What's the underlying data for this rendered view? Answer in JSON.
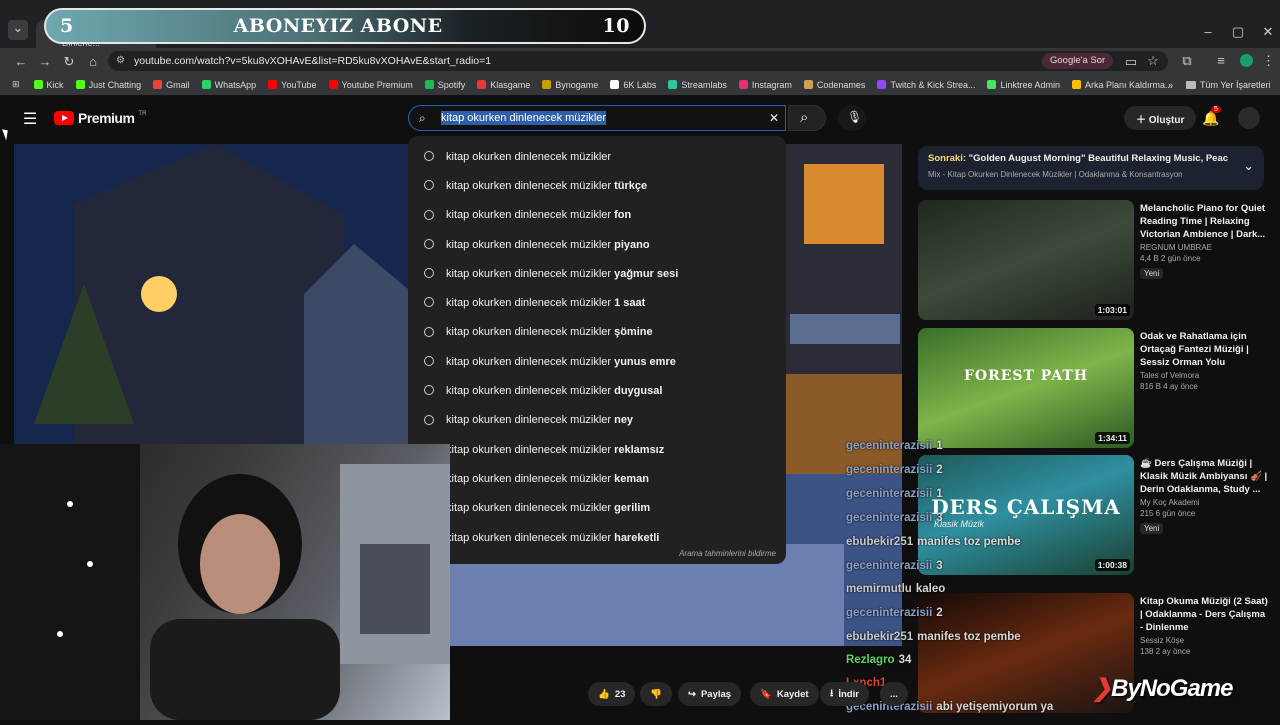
{
  "overlay": {
    "left_number": "5",
    "title": "ABONEYIZ ABONE",
    "right_number": "10"
  },
  "browser": {
    "tab_title": "Kitap Okurken Dinlene...",
    "url": "youtube.com/watch?v=5ku8vXOHAvE&list=RD5ku8vXOHAvE&start_radio=1",
    "google_button": "Google'a Sor",
    "bookmarks": [
      {
        "label": "Kick",
        "color": "#53fc18"
      },
      {
        "label": "Just Chatting",
        "color": "#53fc18"
      },
      {
        "label": "Gmail",
        "color": "#ea4335"
      },
      {
        "label": "WhatsApp",
        "color": "#25d366"
      },
      {
        "label": "YouTube",
        "color": "#ff0000"
      },
      {
        "label": "Youtube Premium",
        "color": "#ff0000"
      },
      {
        "label": "Spotify",
        "color": "#1db954"
      },
      {
        "label": "Klasgame",
        "color": "#e53935"
      },
      {
        "label": "Bynogame",
        "color": "#c8a000"
      },
      {
        "label": "6K Labs",
        "color": "#ffffff"
      },
      {
        "label": "Streamlabs",
        "color": "#31c3a2"
      },
      {
        "label": "Instagram",
        "color": "#e1306c"
      },
      {
        "label": "Codenames",
        "color": "#d0a050"
      },
      {
        "label": "Twitch & Kick Strea...",
        "color": "#9146ff"
      },
      {
        "label": "Linktree Admin",
        "color": "#43e660"
      },
      {
        "label": "Arka Planı Kaldırma...",
        "color": "#f6c000"
      }
    ],
    "bookmarks_more": "»",
    "all_bookmarks": "Tüm Yer İşaretleri"
  },
  "youtube": {
    "logo_text": "Premium",
    "logo_sup": "TR",
    "search_value": "kitap okurken dinlenecek müzikler",
    "create_label": "Oluştur",
    "notif_count": "5",
    "suggestion_base": "kitap okurken dinlenecek müzikler",
    "suggestions": [
      "",
      "türkçe",
      "fon",
      "piyano",
      "yağmur sesi",
      "1 saat",
      "şömine",
      "yunus emre",
      "duygusal",
      "ney",
      "reklamsız",
      "keman",
      "gerilim",
      "hareketli"
    ],
    "suggestion_footer": "Arama tahminlerini bildirme",
    "next": {
      "prefix": "Sonraki:",
      "title": "\"Golden August Morning\" Beautiful Relaxing Music, Peaceful ...",
      "sub": "Mix - Kitap Okurken Dinlenecek Müzikler | Odaklanma & Konsantrasyon"
    },
    "recommendations": [
      {
        "title": "Melancholic Piano for Quiet Reading Time | Relaxing Victorian Ambience | Dark...",
        "channel": "REGNUM UMBRAE",
        "views": "4,4 B",
        "age": "2 gün önce",
        "badge": "Yeni",
        "duration": "1:03:01"
      },
      {
        "title": "Odak ve Rahatlama için Ortaçağ Fantezi Müziği | Sessiz Orman Yolu",
        "channel": "Tales of Velmora",
        "views": "816 B",
        "age": "4 ay önce",
        "badge": "",
        "duration": "1:34:11",
        "thumb_text": "FOREST PATH"
      },
      {
        "title": "☕ Ders Çalışma Müziği | Klasik Müzik Ambiyansı 🎻 | Derin Odaklanma, Study ...",
        "channel": "My Koç Akademi",
        "views": "215",
        "age": "6 gün önce",
        "badge": "Yeni",
        "duration": "1:00:38",
        "thumb_text": "DERS ÇALIŞMA",
        "thumb_sub": "Klasik Müzik"
      },
      {
        "title": "Kitap Okuma Müziği (2 Saat) | Odaklanma - Ders Çalışma - Dinlenme",
        "channel": "Sessiz Köşe",
        "views": "138",
        "age": "2 ay önce",
        "badge": "",
        "duration": ""
      }
    ],
    "actions": {
      "likes": "23",
      "share": "Paylaş",
      "save": "Kaydet",
      "download": "İndir",
      "more": "..."
    }
  },
  "chat": [
    {
      "user": "geceninterazisii",
      "msg": "1"
    },
    {
      "user": "geceninterazisii",
      "msg": "2"
    },
    {
      "user": "geceninterazisii",
      "msg": "1"
    },
    {
      "user": "geceninterazisii",
      "msg": "3"
    },
    {
      "user": "ebubekir251",
      "msg": "manifes toz pembe"
    },
    {
      "user": "geceninterazisii",
      "msg": "3"
    },
    {
      "user": "memirmutlu",
      "msg": "kaleo"
    },
    {
      "user": "geceninterazisii",
      "msg": "2"
    },
    {
      "user": "ebubekir251",
      "msg": "manifes toz pembe"
    },
    {
      "user": "Rezlagro",
      "msg": "34"
    },
    {
      "user": "Lxnch1",
      "msg": ""
    },
    {
      "user": "geceninterazisii",
      "msg": "abi yetişemiyorum ya"
    }
  ],
  "brand": "ByNoGame"
}
